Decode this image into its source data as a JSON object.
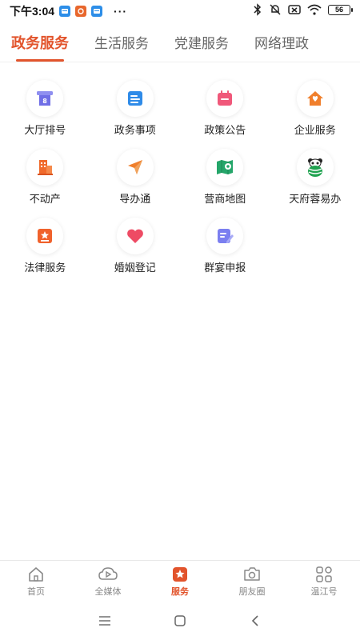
{
  "status_bar": {
    "time": "下午3:04",
    "dots": "···",
    "battery": "56"
  },
  "tabs": [
    {
      "label": "政务服务",
      "active": true
    },
    {
      "label": "生活服务",
      "active": false
    },
    {
      "label": "党建服务",
      "active": false
    },
    {
      "label": "网络理政",
      "active": false
    }
  ],
  "services": [
    {
      "label": "大厅排号",
      "icon": "queue-ticket-icon"
    },
    {
      "label": "政务事项",
      "icon": "document-list-icon"
    },
    {
      "label": "政策公告",
      "icon": "calendar-notice-icon"
    },
    {
      "label": "企业服务",
      "icon": "enterprise-house-icon"
    },
    {
      "label": "不动产",
      "icon": "building-icon"
    },
    {
      "label": "导办通",
      "icon": "navigation-arrow-icon"
    },
    {
      "label": "营商地图",
      "icon": "map-pin-icon"
    },
    {
      "label": "天府蓉易办",
      "icon": "panda-icon"
    },
    {
      "label": "法律服务",
      "icon": "law-badge-icon"
    },
    {
      "label": "婚姻登记",
      "icon": "heart-icon"
    },
    {
      "label": "群宴申报",
      "icon": "edit-form-icon"
    }
  ],
  "bottom_nav": [
    {
      "label": "首页",
      "icon": "home-icon",
      "active": false
    },
    {
      "label": "全媒体",
      "icon": "media-play-icon",
      "active": false
    },
    {
      "label": "服务",
      "icon": "service-star-icon",
      "active": true
    },
    {
      "label": "朋友圈",
      "icon": "camera-icon",
      "active": false
    },
    {
      "label": "温江号",
      "icon": "grid-apps-icon",
      "active": false
    }
  ],
  "colors": {
    "accent": "#e2542c",
    "inactive_tab": "#666666",
    "nav_inactive": "#888888"
  }
}
